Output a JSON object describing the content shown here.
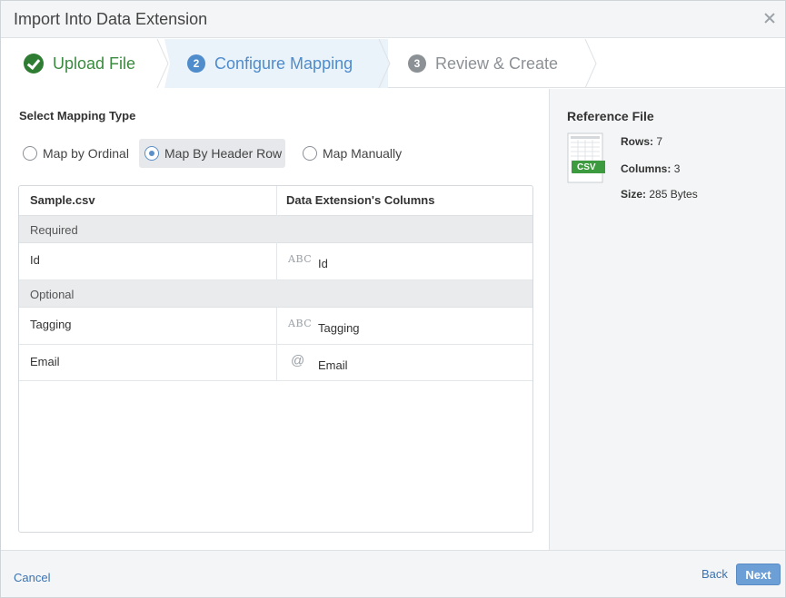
{
  "dialog": {
    "title": "Import Into Data Extension"
  },
  "steps": [
    {
      "number": "",
      "label": "Upload File",
      "state": "complete"
    },
    {
      "number": "2",
      "label": "Configure Mapping",
      "state": "active"
    },
    {
      "number": "3",
      "label": "Review & Create",
      "state": "pending"
    }
  ],
  "mapping": {
    "section_title": "Select Mapping Type",
    "options": [
      {
        "label": "Map by Ordinal",
        "selected": false
      },
      {
        "label": "Map By Header Row",
        "selected": true
      },
      {
        "label": "Map Manually",
        "selected": false
      }
    ]
  },
  "table": {
    "headers": [
      "Sample.csv",
      "Data Extension's Columns"
    ],
    "groups": [
      {
        "label": "Required",
        "rows": [
          {
            "source": "Id",
            "type_icon": "text-type-icon",
            "type_glyph": "ABC",
            "target": "Id"
          }
        ]
      },
      {
        "label": "Optional",
        "rows": [
          {
            "source": "Tagging",
            "type_icon": "text-type-icon",
            "type_glyph": "ABC",
            "target": "Tagging"
          },
          {
            "source": "Email",
            "type_icon": "email-type-icon",
            "type_glyph": "@",
            "target": "Email"
          }
        ]
      }
    ]
  },
  "reference": {
    "title": "Reference File",
    "file_badge": "csv",
    "rows_label": "Rows:",
    "rows_value": "7",
    "columns_label": "Columns:",
    "columns_value": "3",
    "size_label": "Size:",
    "size_value": "285 Bytes"
  },
  "footer": {
    "cancel_label": "Cancel",
    "back_label": "Back",
    "next_label": "Next"
  },
  "colors": {
    "complete": "#3a8a3f",
    "active": "#4f8ccc",
    "pending": "#8c9196",
    "primary_button": "#6b9fd6",
    "link": "#3a73b3",
    "csv_badge": "#3c9a3f"
  }
}
